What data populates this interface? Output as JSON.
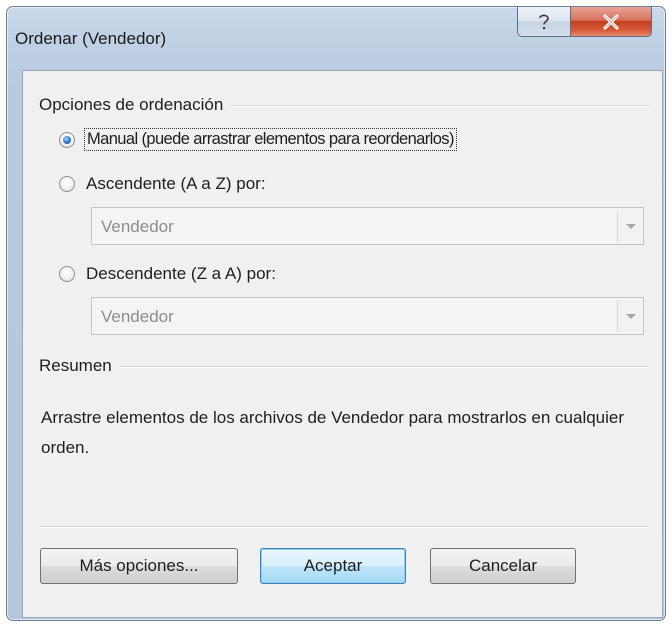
{
  "window": {
    "title": "Ordenar (Vendedor)",
    "help_icon": "question-mark-icon",
    "close_icon": "close-x-icon"
  },
  "sort_options": {
    "group_label": "Opciones de ordenación",
    "manual_label": "Manual (puede arrastrar elementos para reordenarlos)",
    "ascending_label": "Ascendente (A a Z) por:",
    "descending_label": "Descendente (Z a A) por:",
    "selected": "manual",
    "ascending_field": "Vendedor",
    "descending_field": "Vendedor"
  },
  "summary": {
    "group_label": "Resumen",
    "text": "Arrastre elementos de los archivos de Vendedor para mostrarlos en cualquier orden."
  },
  "buttons": {
    "more_options": "Más opciones...",
    "accept": "Aceptar",
    "cancel": "Cancelar"
  },
  "colors": {
    "close_button": "#c4401f",
    "radio_selected": "#2b74c7",
    "default_button_border": "#3c7fb1"
  }
}
